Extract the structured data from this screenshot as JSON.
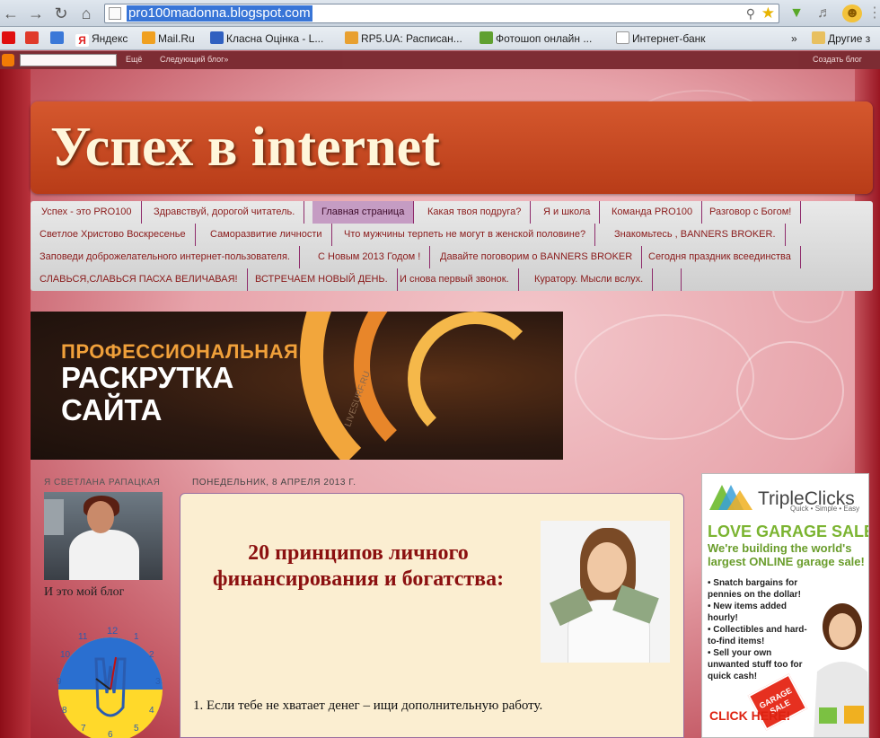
{
  "browser": {
    "url": "pro100madonna.blogspot.com",
    "bookmarks": [
      {
        "label": "Яндекс",
        "color": "#e02020"
      },
      {
        "label": "Mail.Ru",
        "color": "#f0a020"
      },
      {
        "label": "Класна Оцінка - L...",
        "color": "#3060c0"
      },
      {
        "label": "RP5.UA: Расписан...",
        "color": "#e8a030"
      },
      {
        "label": "Фотошоп онлайн ...",
        "color": "#60a030"
      },
      {
        "label": "Интернет-банк",
        "color": "#ffffff"
      }
    ],
    "more": "»",
    "other_bookmarks": "Другие з"
  },
  "blognav": {
    "search_label": "Ещё",
    "next_blog": "Следующий блог»",
    "create_blog": "Создать блог"
  },
  "blog": {
    "title": "Успех в internet",
    "menu_rows": [
      [
        "Успех - это PRO100",
        "Здравствуй, дорогой читатель.",
        "Главная страница",
        "Какая твоя подруга?",
        "Я и школа",
        "Команда PRO100",
        "Разговор с Богом!"
      ],
      [
        "Светлое Христово Воскресенье",
        "Саморазвитие личности",
        "Что мужчины терпеть не могут в женской половине?",
        "Знакомьтесь , BANNERS BROKER."
      ],
      [
        "Заповеди доброжелательного интернет-пользователя.",
        "С Новым 2013 Годом !",
        "Давайте поговорим о BANNERS BROKER",
        "Сегодня праздник всеединства"
      ],
      [
        "СЛАВЬСЯ,СЛАВЬСЯ ПАСХА ВЕЛИЧАВАЯ!",
        "ВСТРЕЧАЕМ НОВЫЙ ДЕНЬ.",
        "И снова первый звонок.",
        "Куратору. Мысли вслух.",
        ""
      ]
    ],
    "active_tab": "Главная страница",
    "banner": {
      "line1": "ПРОФЕССИОНАЛЬНАЯ",
      "line2": "РАСКРУТКА",
      "line3": "САЙТА",
      "watermark": "LIVESURF.RU"
    }
  },
  "sidebar": {
    "profile_title": "Я СВЕТЛАНА РАПАЦКАЯ",
    "caption": "И это мой блог",
    "clock_numbers": [
      "12",
      "1",
      "2",
      "3",
      "4",
      "5",
      "6",
      "7",
      "8",
      "9",
      "10",
      "11"
    ]
  },
  "post": {
    "date": "ПОНЕДЕЛЬНИК, 8 АПРЕЛЯ 2013 Г.",
    "title": "20 принципов личного финансирования и богатства:",
    "paragraph1": "1. Если тебе не хватает денег – ищи дополнительную работу."
  },
  "ad": {
    "brand": "TripleClicks",
    "tagline": "Quick • Simple • Easy",
    "headline": "LOVE GARAGE SALES?",
    "subheadline": "We're building the world's largest ONLINE garage sale!",
    "bullets": [
      "• Snatch bargains for pennies on the dollar!",
      "• New items added hourly!",
      "• Collectibles and hard-to-find items!",
      "• Sell your own unwanted stuff too for quick cash!"
    ],
    "sign": "GARAGE SALE",
    "cta": "CLICK HERE!"
  },
  "colors": {
    "header_bg": "#c94a22",
    "post_title": "#8b1010",
    "active_tab": "#c59cc3",
    "ad_green": "#7bb431"
  }
}
